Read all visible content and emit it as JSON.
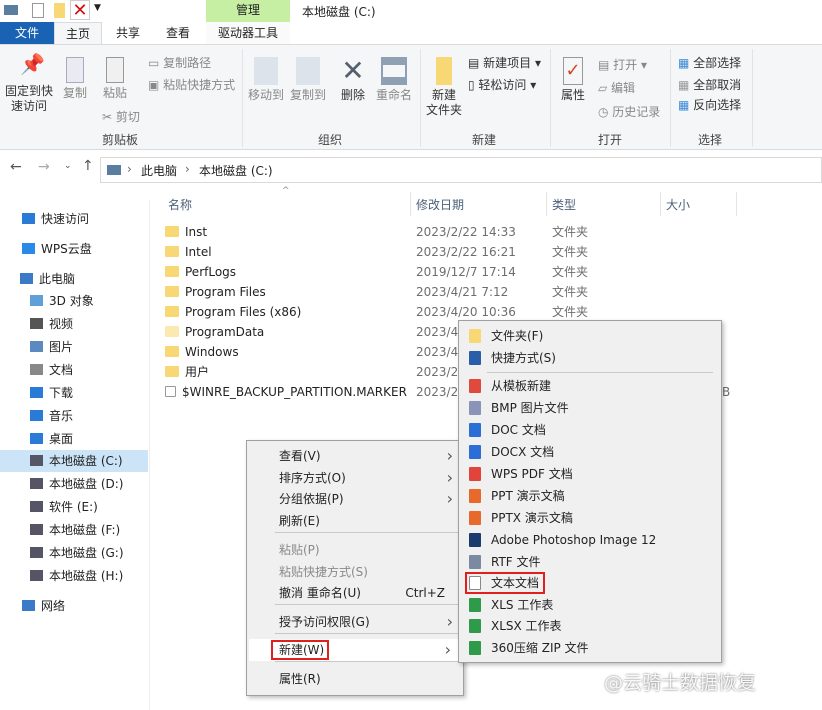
{
  "window": {
    "title": "本地磁盘 (C:)",
    "context_tab": "管理",
    "context_tab_color": "#c6efa3"
  },
  "tabs": [
    {
      "label": "文件"
    },
    {
      "label": "主页"
    },
    {
      "label": "共享"
    },
    {
      "label": "查看"
    },
    {
      "label": "驱动器工具"
    }
  ],
  "ribbon": {
    "clipboard": {
      "label": "剪贴板",
      "pin1": "固定到快",
      "pin2": "速访问",
      "copy": "复制",
      "paste": "粘贴",
      "copy_path": "复制路径",
      "paste_shortcut": "粘贴快捷方式",
      "cut": "剪切"
    },
    "organize": {
      "label": "组织",
      "move_to": "移动到",
      "copy_to": "复制到",
      "delete": "删除",
      "rename": "重命名"
    },
    "new": {
      "label": "新建",
      "new_folder1": "新建",
      "new_folder2": "文件夹",
      "new_item": "新建项目",
      "easy_access": "轻松访问"
    },
    "open": {
      "label": "打开",
      "properties": "属性",
      "open": "打开",
      "edit": "编辑",
      "history": "历史记录"
    },
    "select": {
      "label": "选择",
      "select_all": "全部选择",
      "select_none": "全部取消",
      "invert": "反向选择"
    }
  },
  "address": {
    "path": [
      "此电脑",
      "本地磁盘 (C:)"
    ]
  },
  "sidebar": [
    {
      "label": "快速访问",
      "icon": "star-icon"
    },
    {
      "label": "WPS云盘",
      "icon": "cloud-icon"
    },
    {
      "label": "此电脑",
      "icon": "computer-icon"
    },
    {
      "label": "3D 对象",
      "icon": "cube-icon"
    },
    {
      "label": "视频",
      "icon": "video-icon"
    },
    {
      "label": "图片",
      "icon": "picture-icon"
    },
    {
      "label": "文档",
      "icon": "document-icon"
    },
    {
      "label": "下载",
      "icon": "download-icon"
    },
    {
      "label": "音乐",
      "icon": "music-icon"
    },
    {
      "label": "桌面",
      "icon": "desktop-icon"
    },
    {
      "label": "本地磁盘 (C:)",
      "icon": "drive-icon"
    },
    {
      "label": "本地磁盘 (D:)",
      "icon": "drive-icon"
    },
    {
      "label": "软件 (E:)",
      "icon": "drive-icon"
    },
    {
      "label": "本地磁盘 (F:)",
      "icon": "drive-icon"
    },
    {
      "label": "本地磁盘 (G:)",
      "icon": "drive-icon"
    },
    {
      "label": "本地磁盘 (H:)",
      "icon": "drive-icon"
    },
    {
      "label": "网络",
      "icon": "network-icon"
    }
  ],
  "columns": [
    "名称",
    "修改日期",
    "类型",
    "大小"
  ],
  "files": [
    {
      "name": "Inst",
      "date": "2023/2/22 14:33",
      "type": "文件夹"
    },
    {
      "name": "Intel",
      "date": "2023/2/22 16:21",
      "type": "文件夹"
    },
    {
      "name": "PerfLogs",
      "date": "2019/12/7 17:14",
      "type": "文件夹"
    },
    {
      "name": "Program Files",
      "date": "2023/4/21 7:12",
      "type": "文件夹"
    },
    {
      "name": "Program Files (x86)",
      "date": "2023/4/20 10:36",
      "type": "文件夹"
    },
    {
      "name": "ProgramData",
      "date": "2023/4/",
      "type": ""
    },
    {
      "name": "Windows",
      "date": "2023/4/",
      "type": ""
    },
    {
      "name": "用户",
      "date": "2023/2/",
      "type": ""
    },
    {
      "name": "$WINRE_BACKUP_PARTITION.MARKER",
      "date": "2023/2/",
      "type": "",
      "size": "B"
    }
  ],
  "context_menu": [
    {
      "label": "查看(V)",
      "arrow": true
    },
    {
      "label": "排序方式(O)",
      "arrow": true
    },
    {
      "label": "分组依据(P)",
      "arrow": true
    },
    {
      "label": "刷新(E)"
    },
    {
      "label": "粘贴(P)",
      "disabled": true
    },
    {
      "label": "粘贴快捷方式(S)",
      "disabled": true
    },
    {
      "label": "撤消 重命名(U)",
      "shortcut": "Ctrl+Z"
    },
    {
      "label": "授予访问权限(G)",
      "arrow": true
    },
    {
      "label": "新建(W)",
      "arrow": true,
      "highlighted": true
    },
    {
      "label": "属性(R)"
    }
  ],
  "submenu": [
    {
      "label": "文件夹(F)",
      "color": "#f8d775"
    },
    {
      "label": "快捷方式(S)",
      "color": "#2a5ea8"
    },
    {
      "label": "从模板新建",
      "color": "#e04a3c"
    },
    {
      "label": "BMP 图片文件",
      "color": "#8a94b8"
    },
    {
      "label": "DOC 文档",
      "color": "#2b6fd6"
    },
    {
      "label": "DOCX 文档",
      "color": "#2b6fd6"
    },
    {
      "label": "WPS PDF 文档",
      "color": "#e0443a"
    },
    {
      "label": "PPT 演示文稿",
      "color": "#e8692c"
    },
    {
      "label": "PPTX 演示文稿",
      "color": "#e8692c"
    },
    {
      "label": "Adobe Photoshop Image 12",
      "color": "#1c3a6e"
    },
    {
      "label": "RTF 文件",
      "color": "#7a8aa0"
    },
    {
      "label": "文本文档",
      "color": "#ffffff",
      "highlighted": true
    },
    {
      "label": "XLS 工作表",
      "color": "#2e9a4a"
    },
    {
      "label": "XLSX 工作表",
      "color": "#2e9a4a"
    },
    {
      "label": "360压缩 ZIP 文件",
      "color": "#2e9a4a"
    }
  ],
  "watermark": "@云骑士数据恢复",
  "highlight_color": "#e0201c"
}
